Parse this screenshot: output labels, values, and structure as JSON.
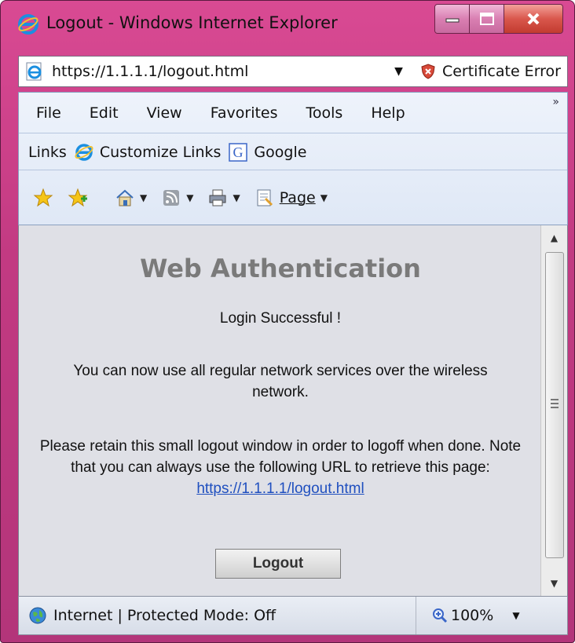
{
  "window": {
    "title": "Logout - Windows Internet Explorer",
    "icon": "ie-icon"
  },
  "address": {
    "url": "https://1.1.1.1/logout.html",
    "cert_label": "Certificate Error",
    "cert_icon": "shield-x-icon"
  },
  "menu": {
    "items": [
      "File",
      "Edit",
      "View",
      "Favorites",
      "Tools",
      "Help"
    ]
  },
  "links": {
    "label": "Links",
    "items": [
      {
        "label": "Customize Links",
        "icon": "ie-icon"
      },
      {
        "label": "Google",
        "icon": "google-icon"
      }
    ]
  },
  "command_bar": {
    "page_label": "Page",
    "overflow": "»"
  },
  "page": {
    "heading": "Web Authentication",
    "line1": "Login Successful !",
    "line2": "You can now use all regular network services over the wireless network.",
    "line3": "Please retain this small logout window in order to logoff when done. Note that you can always use the following URL to retrieve this page:",
    "link": "https://1.1.1.1/logout.html",
    "button": "Logout"
  },
  "status": {
    "zone": "Internet | Protected Mode: Off",
    "zoom": "100%"
  },
  "colors": {
    "title_bar": "#c23a82",
    "content_bg": "#dfe0e6",
    "heading": "#7a7a7a",
    "link": "#1f4fbf"
  }
}
